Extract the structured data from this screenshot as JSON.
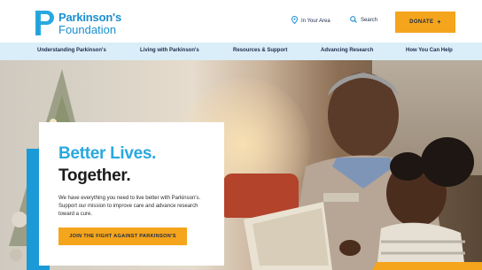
{
  "header": {
    "logo": {
      "name": "Parkinson's",
      "sub": "Foundation"
    },
    "utility": {
      "area_label": "In Your Area",
      "search_label": "Search"
    },
    "donate": {
      "label": "DONATE",
      "plus": "+"
    }
  },
  "nav": {
    "items": [
      {
        "label": "Understanding Parkinson's"
      },
      {
        "label": "Living with Parkinson's"
      },
      {
        "label": "Resources & Support"
      },
      {
        "label": "Advancing Research"
      },
      {
        "label": "How You Can Help"
      }
    ]
  },
  "hero": {
    "headline_1": "Better Lives.",
    "headline_2": "Together.",
    "body": "We have everything you need to live better with Parkinson's. Support our mission to improve care and advance research toward a cure.",
    "cta_label": "JOIN THE FIGHT AGAINST PARKINSON'S"
  },
  "colors": {
    "brand_blue": "#1a8fd1",
    "accent_blue": "#29a8df",
    "accent_yellow": "#f4a51c",
    "nav_bg": "#d9eef8",
    "text_dark": "#1c2a4a"
  }
}
